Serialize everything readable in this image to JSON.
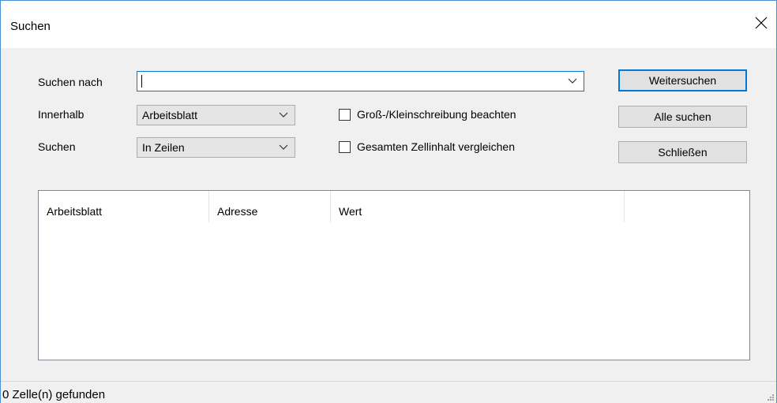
{
  "window": {
    "title": "Suchen",
    "close_icon": "close-icon"
  },
  "form": {
    "search_label": "Suchen nach",
    "search_value": "",
    "within_label": "Innerhalb",
    "within_value": "Arbeitsblatt",
    "search_dir_label": "Suchen",
    "search_dir_value": "In Zeilen",
    "match_case_label": "Groß-/Kleinschreibung beachten",
    "match_case_checked": false,
    "whole_cell_label": "Gesamten Zellinhalt vergleichen",
    "whole_cell_checked": false
  },
  "buttons": {
    "find_next": "Weitersuchen",
    "find_all": "Alle suchen",
    "close": "Schließen"
  },
  "results": {
    "columns": [
      "Arbeitsblatt",
      "Adresse",
      "Wert",
      ""
    ],
    "rows": []
  },
  "status": {
    "text": "0 Zelle(n) gefunden"
  },
  "colors": {
    "accent": "#0078d7",
    "border": "#4a8fd3"
  }
}
